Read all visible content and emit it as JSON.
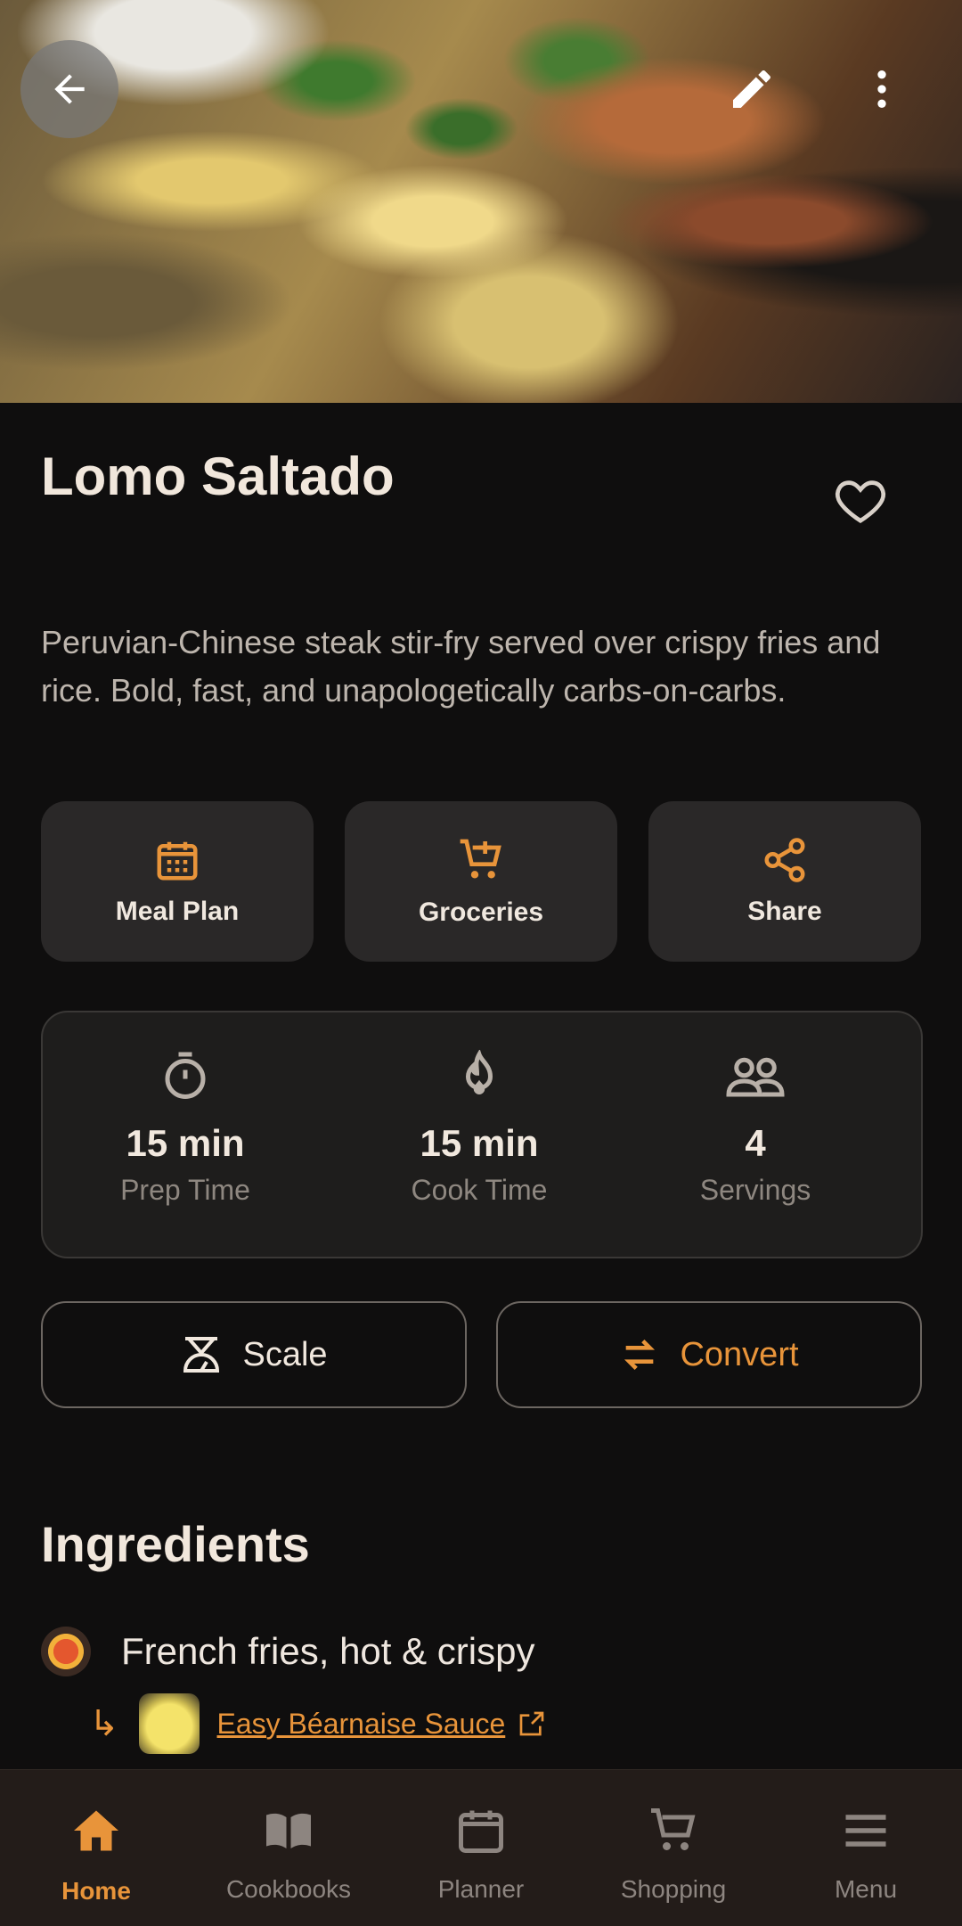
{
  "header": {
    "back_icon": "arrow-left-icon",
    "edit_icon": "pencil-icon",
    "more_icon": "more-vertical-icon"
  },
  "recipe": {
    "title": "Lomo Saltado",
    "description": "Peruvian-Chinese steak stir-fry served over crispy fries and rice. Bold, fast, and unapologetically carbs-on-carbs."
  },
  "actions": [
    {
      "label": "Meal Plan",
      "icon": "calendar-icon"
    },
    {
      "label": "Groceries",
      "icon": "cart-plus-icon"
    },
    {
      "label": "Share",
      "icon": "share-icon"
    }
  ],
  "stats": [
    {
      "value": "15 min",
      "label": "Prep Time",
      "icon": "timer-icon"
    },
    {
      "value": "15 min",
      "label": "Cook Time",
      "icon": "flame-icon"
    },
    {
      "value": "4",
      "label": "Servings",
      "icon": "people-icon"
    }
  ],
  "tools": {
    "scale_label": "Scale",
    "convert_label": "Convert"
  },
  "ingredients": {
    "title": "Ingredients",
    "items": [
      {
        "text": "French fries, hot & crispy",
        "sub_recipe": "Easy Béarnaise Sauce"
      }
    ]
  },
  "nav": [
    {
      "label": "Home",
      "icon": "home-icon",
      "active": true
    },
    {
      "label": "Cookbooks",
      "icon": "book-icon"
    },
    {
      "label": "Planner",
      "icon": "calendar-icon"
    },
    {
      "label": "Shopping",
      "icon": "cart-icon"
    },
    {
      "label": "Menu",
      "icon": "menu-icon"
    }
  ],
  "colors": {
    "accent": "#e8943a",
    "background": "#0f0e0e",
    "card": "#2a2828",
    "nav_bg": "#231c19"
  }
}
